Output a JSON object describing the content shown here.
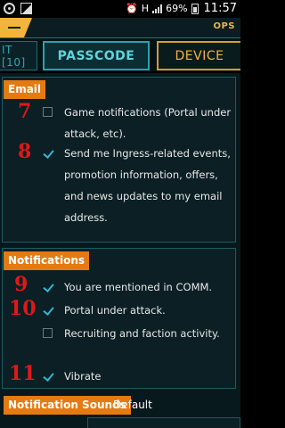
{
  "status_bar": {
    "network": "H",
    "signal_small": "↑↓",
    "battery": "69%",
    "time": "11:57"
  },
  "top_bar": {
    "right_label": "OPS"
  },
  "tabs": [
    {
      "label": "IT [10]"
    },
    {
      "label": "PASSCODE"
    },
    {
      "label": "DEVICE"
    }
  ],
  "email": {
    "header": "Email",
    "items": [
      {
        "num": "7",
        "checked": false,
        "text": "Game notifications (Portal under attack, etc)."
      },
      {
        "num": "8",
        "checked": true,
        "text": "Send me Ingress-related events, promotion information, offers, and news updates to my email address."
      }
    ]
  },
  "notifications": {
    "header": "Notifications",
    "items": [
      {
        "num": "9",
        "checked": true,
        "text": "You are mentioned in COMM."
      },
      {
        "num": "10",
        "checked": true,
        "text": "Portal under attack."
      },
      {
        "num": "",
        "checked": false,
        "text": "Recruiting and faction activity."
      },
      {
        "num": "11",
        "checked": true,
        "text": "Vibrate"
      }
    ]
  },
  "notification_sounds": {
    "header": "Notification Sounds",
    "value": "Default"
  },
  "colors": {
    "accent_orange": "#e47a12",
    "accent_teal": "#2aa2ac",
    "annotation_red": "#e01818",
    "check_blue": "#37b3cc"
  }
}
